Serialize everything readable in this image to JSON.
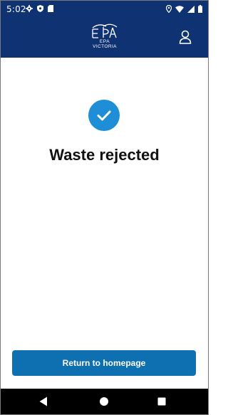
{
  "status_bar": {
    "time": "5:02",
    "left_icons": [
      "settings-icon",
      "shield-icon",
      "sd-card-icon"
    ],
    "right_icons": [
      "location-icon",
      "wifi-icon",
      "signal-icon",
      "battery-icon"
    ]
  },
  "header": {
    "logo_line1": "EPA",
    "logo_line2": "VICTORIA",
    "background_color": "#0f3273",
    "profile_icon": "user-icon"
  },
  "main": {
    "status_icon": "check-icon",
    "accent_color": "#1e8fd6",
    "title": "Waste rejected"
  },
  "footer": {
    "button_label": "Return to homepage",
    "button_color": "#0e6fb1"
  },
  "nav_bar": {
    "icons": [
      "back-icon",
      "home-icon",
      "recents-icon"
    ]
  }
}
